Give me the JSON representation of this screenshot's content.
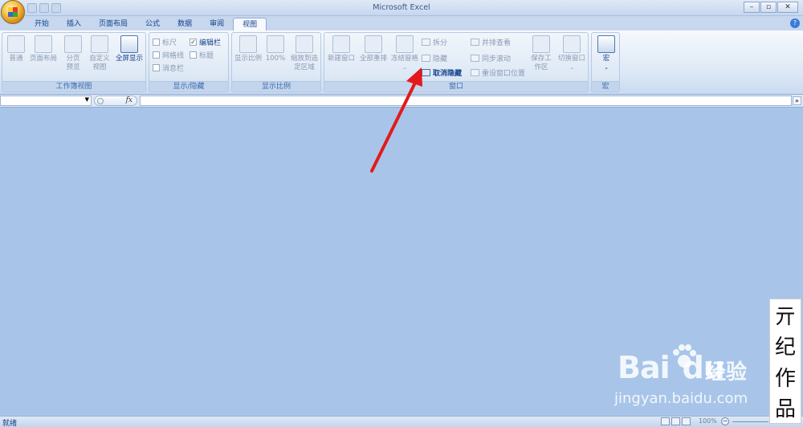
{
  "window": {
    "title": "Microsoft Excel",
    "controls": [
      "–",
      "▫",
      "✕"
    ]
  },
  "tabs": [
    "开始",
    "插入",
    "页面布局",
    "公式",
    "数据",
    "审阅",
    "视图"
  ],
  "active_tab": "视图",
  "groups": {
    "workbook_views": {
      "label": "工作簿视图",
      "buttons": [
        "普通",
        "页面布局",
        "分页预览",
        "自定义视图",
        "全屏显示"
      ]
    },
    "show_hide": {
      "label": "显示/隐藏",
      "checkboxes": [
        {
          "label": "标尺",
          "checked": false,
          "enabled": false
        },
        {
          "label": "编辑栏",
          "checked": true,
          "enabled": true
        },
        {
          "label": "网格线",
          "checked": false,
          "enabled": false
        },
        {
          "label": "标题",
          "checked": false,
          "enabled": false
        },
        {
          "label": "消息栏",
          "checked": false,
          "enabled": false
        }
      ]
    },
    "zoom": {
      "label": "显示比例",
      "buttons": [
        "显示比例",
        "100%",
        "缩放到选定区域"
      ]
    },
    "window_group": {
      "label": "窗口",
      "buttons": [
        "新建窗口",
        "全部重排",
        "冻结窗格",
        "保存工作区",
        "切换窗口"
      ],
      "small_buttons": [
        "拆分",
        "隐藏",
        "取消隐藏",
        "并排查看",
        "同步滚动",
        "重设窗口位置"
      ]
    },
    "macros": {
      "label": "宏",
      "button": "宏"
    }
  },
  "formula_bar": {
    "fx": "fx",
    "dropdown": "▼",
    "expand": "»"
  },
  "status": {
    "ready": "就绪",
    "zoom": "100%",
    "zoom_minus": "−"
  },
  "watermark": {
    "brand": "Bai",
    "brand2": "du",
    "cn": "经验",
    "url": "jingyan.baidu.com"
  },
  "signature": [
    "亓",
    "纪",
    "作",
    "品"
  ],
  "colors": {
    "accent": "#15428b",
    "workspace": "#a8c5e9",
    "arrow": "#e3191b"
  }
}
